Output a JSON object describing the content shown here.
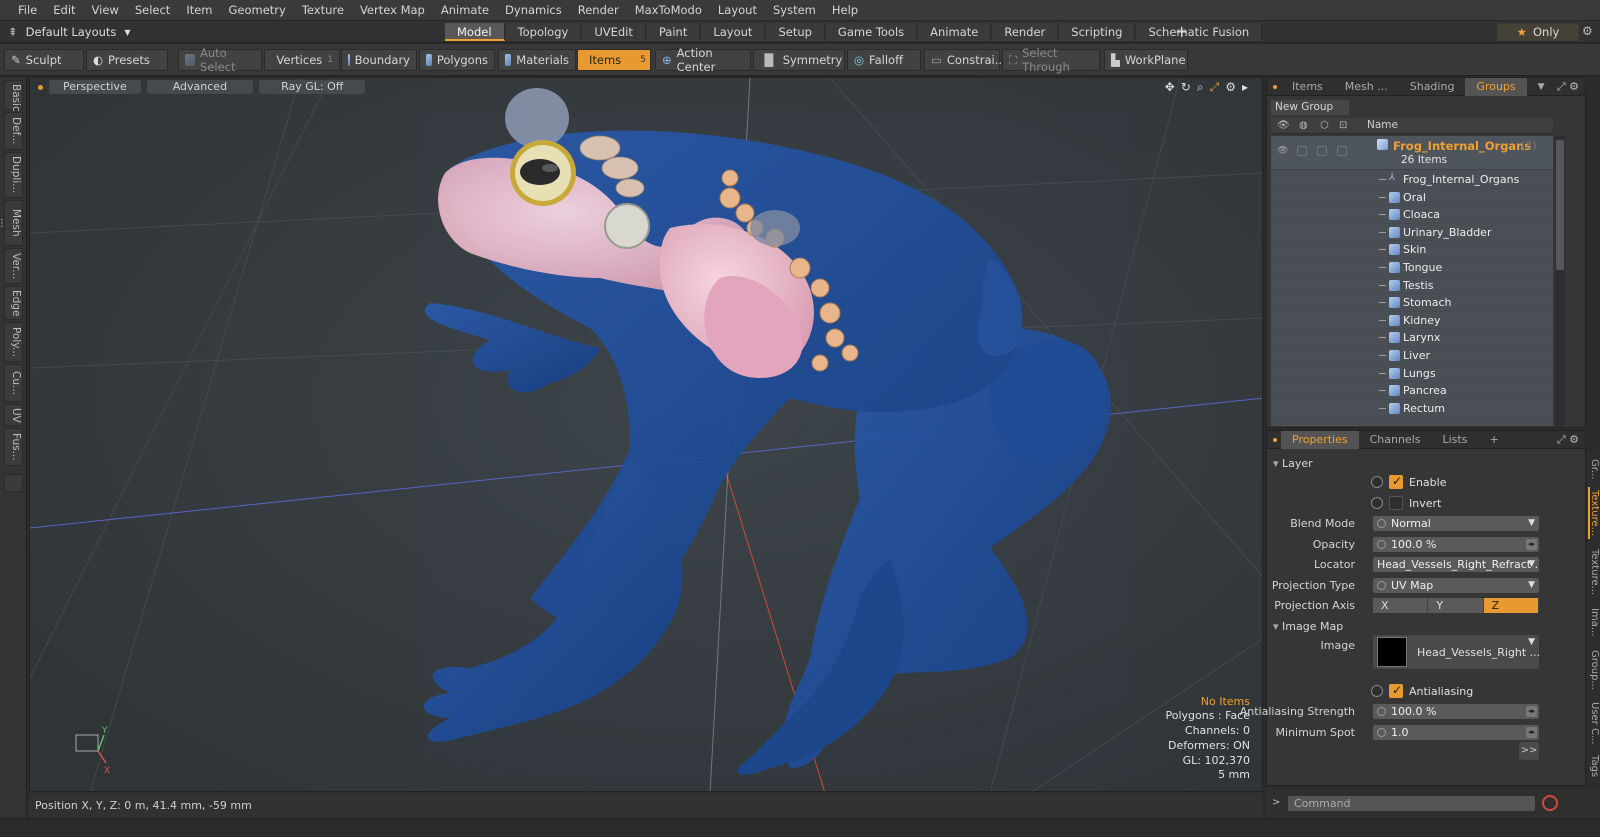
{
  "menu": [
    "File",
    "Edit",
    "View",
    "Select",
    "Item",
    "Geometry",
    "Texture",
    "Vertex Map",
    "Animate",
    "Dynamics",
    "Render",
    "MaxToModo",
    "Layout",
    "System",
    "Help"
  ],
  "layouts": {
    "current": "Default Layouts",
    "tabs": [
      "Model",
      "Topology",
      "UVEdit",
      "Paint",
      "Layout",
      "Setup",
      "Game Tools",
      "Animate",
      "Render",
      "Scripting",
      "Schematic Fusion"
    ],
    "active_tab": "Model",
    "only_label": "Only"
  },
  "toolbar": {
    "sculpt": "Sculpt",
    "presets": "Presets",
    "auto_select": "Auto Select",
    "vertices": "Vertices",
    "vertices_count": "1",
    "boundary": "Boundary",
    "polygons": "Polygons",
    "materials": "Materials",
    "items": "Items",
    "items_count": "5",
    "action_center": "Action Center",
    "symmetry": "Symmetry",
    "falloff": "Falloff",
    "constraints": "Constrai...",
    "select_through": "Select Through",
    "workplane": "WorkPlane"
  },
  "left_tabs": [
    "Basic",
    "Def...",
    "Dupli...",
    "Mesh ...",
    "Ver...",
    "Edge",
    "Poly...",
    "Cu...",
    "UV",
    "Fus..."
  ],
  "viewport": {
    "view": "Perspective",
    "mode": "Advanced",
    "raygl": "Ray GL: Off",
    "stats": {
      "selection": "No Items",
      "polygons": "Polygons : Face",
      "channels": "Channels: 0",
      "deformers": "Deformers: ON",
      "gl": "GL: 102,370",
      "unit": "5 mm"
    },
    "colors": {
      "frog_body": "#1f4f9a",
      "organs": "#e8b8c8",
      "background": "#343a3e"
    }
  },
  "status": {
    "position": "Position X, Y, Z:   0 m, 41.4 mm, -59 mm"
  },
  "outliner": {
    "tabs": [
      "Items",
      "Mesh ...",
      "Shading",
      "Groups"
    ],
    "active_tab": "Groups",
    "new_group": "New Group",
    "column_name": "Name",
    "group": {
      "name": "Frog_Internal_Organs",
      "count": "(3)",
      "items": "26 Items"
    },
    "children": [
      "Frog_Internal_Organs",
      "Oral",
      "Cloaca",
      "Urinary_Bladder",
      "Skin",
      "Tongue",
      "Testis",
      "Stomach",
      "Kidney",
      "Larynx",
      "Liver",
      "Lungs",
      "Pancrea",
      "Rectum"
    ]
  },
  "properties": {
    "tabs": [
      "Properties",
      "Channels",
      "Lists"
    ],
    "active_tab": "Properties",
    "layer_section": "Layer",
    "enable": "Enable",
    "invert": "Invert",
    "blend_mode_label": "Blend Mode",
    "blend_mode": "Normal",
    "opacity_label": "Opacity",
    "opacity": "100.0 %",
    "locator_label": "Locator",
    "locator": "Head_Vessels_Right_Refract ...",
    "projection_type_label": "Projection Type",
    "projection_type": "UV Map",
    "projection_axis_label": "Projection Axis",
    "axes": [
      "X",
      "Y",
      "Z"
    ],
    "active_axis": "Z",
    "image_map_section": "Image Map",
    "image_label": "Image",
    "image": "Head_Vessels_Right ...",
    "antialiasing": "Antialiasing",
    "aa_strength_label": "Antialiasing Strength",
    "aa_strength": "100.0 %",
    "min_spot_label": "Minimum Spot",
    "min_spot": "1.0",
    "more": ">>"
  },
  "right_vtabs": [
    "Gr...",
    "Texture...",
    "Texture...",
    "Ima...",
    "Group...",
    "User C...",
    "Tags"
  ],
  "command": {
    "placeholder": "Command"
  }
}
